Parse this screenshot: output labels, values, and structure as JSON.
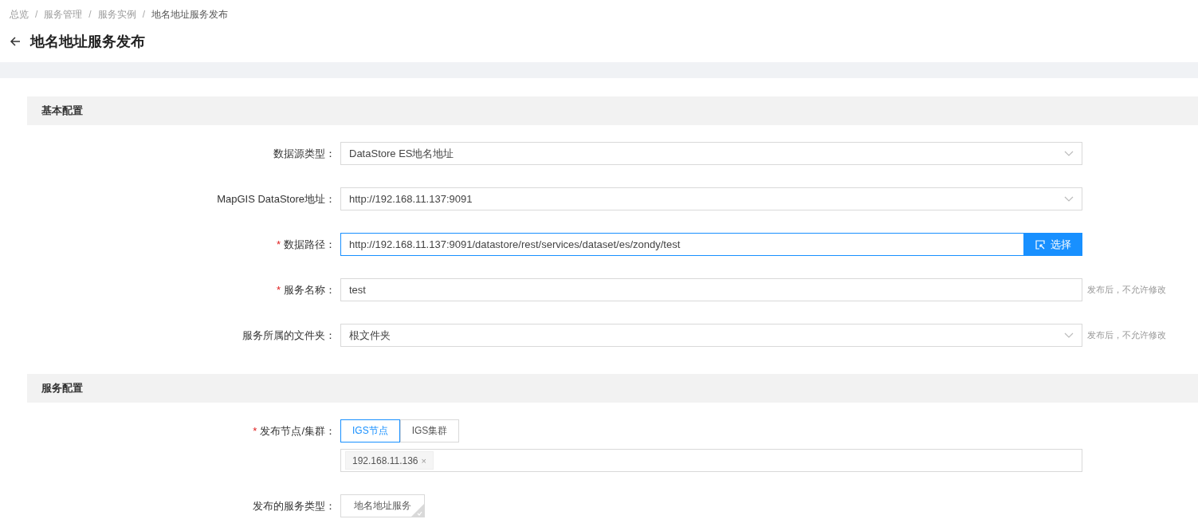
{
  "breadcrumb": [
    {
      "label": "总览",
      "current": false
    },
    {
      "label": "服务管理",
      "current": false
    },
    {
      "label": "服务实例",
      "current": false
    },
    {
      "label": "地名地址服务发布",
      "current": true
    }
  ],
  "breadcrumb_separator": "/",
  "required_mark": "*",
  "page_title": "地名地址服务发布",
  "sections": [
    {
      "title": "基本配置",
      "rows": [
        {
          "kind": "select",
          "label": "数据源类型：",
          "required": false,
          "value": "DataStore ES地名地址",
          "focused": false
        },
        {
          "kind": "select",
          "label": "MapGIS DataStore地址：",
          "required": false,
          "value": "http://192.168.11.137:9091",
          "focused": false
        },
        {
          "kind": "picker",
          "label": "数据路径：",
          "required": true,
          "value": "http://192.168.11.137:9091/datastore/rest/services/dataset/es/zondy/test",
          "focused": true,
          "button": "选择"
        },
        {
          "kind": "input",
          "label": "服务名称：",
          "required": true,
          "value": "test",
          "focused": false,
          "note": "发布后，不允许修改"
        },
        {
          "kind": "select",
          "label": "服务所属的文件夹：",
          "required": false,
          "value": "根文件夹",
          "focused": false,
          "note": "发布后，不允许修改"
        }
      ]
    },
    {
      "title": "服务配置",
      "rows": [
        {
          "kind": "segmented",
          "label": "发布节点/集群：",
          "required": true,
          "options": [
            {
              "label": "IGS节点",
              "selected": true
            },
            {
              "label": "IGS集群",
              "selected": false
            }
          ],
          "tags": [
            "192.168.11.136"
          ],
          "tag_close": "×"
        },
        {
          "kind": "cards",
          "label": "发布的服务类型：",
          "required": false,
          "cards": [
            {
              "label": "地名地址服务",
              "checked": true
            }
          ]
        }
      ]
    }
  ]
}
